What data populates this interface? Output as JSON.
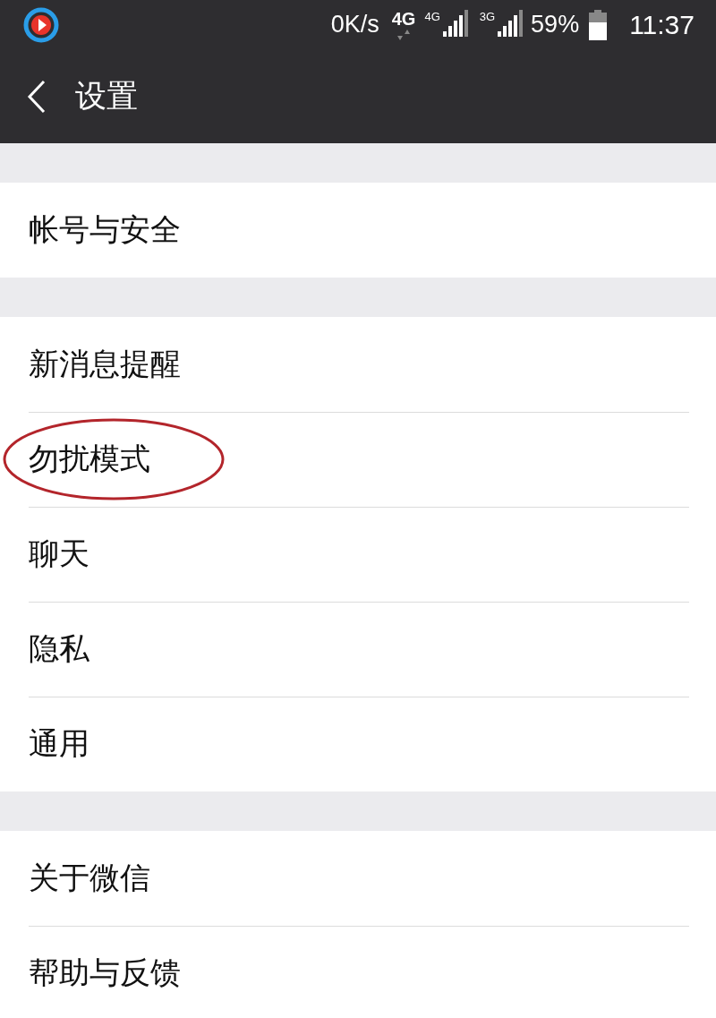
{
  "status_bar": {
    "speed": "0K/s",
    "network_1": "4G",
    "network_2": "4G",
    "network_3": "3G",
    "battery": "59%",
    "time": "11:37"
  },
  "header": {
    "title": "设置"
  },
  "sections": [
    {
      "items": [
        {
          "label": "帐号与安全",
          "circled": false
        }
      ]
    },
    {
      "items": [
        {
          "label": "新消息提醒",
          "circled": false
        },
        {
          "label": "勿扰模式",
          "circled": true
        },
        {
          "label": "聊天",
          "circled": false
        },
        {
          "label": "隐私",
          "circled": false
        },
        {
          "label": "通用",
          "circled": false
        }
      ]
    },
    {
      "items": [
        {
          "label": "关于微信",
          "circled": false
        },
        {
          "label": "帮助与反馈",
          "circled": false
        }
      ]
    }
  ]
}
